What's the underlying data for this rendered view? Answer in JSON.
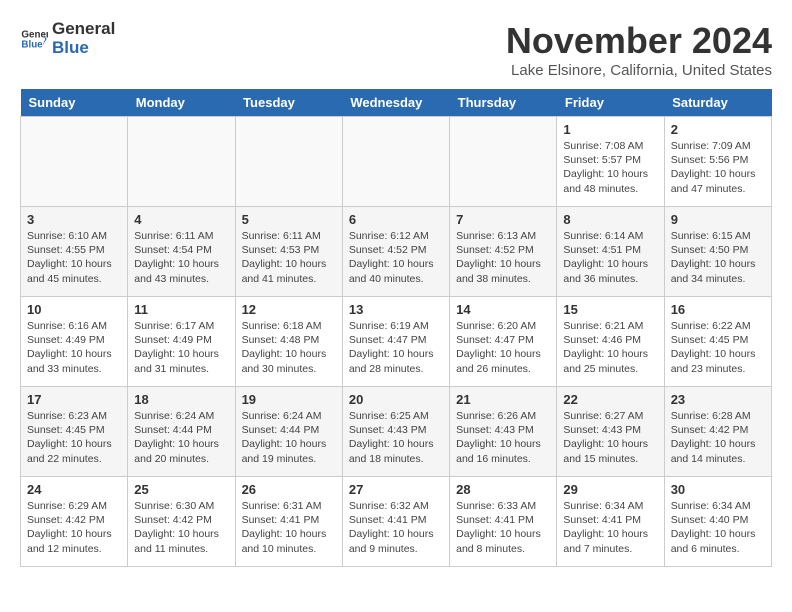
{
  "logo": {
    "line1": "General",
    "line2": "Blue"
  },
  "title": "November 2024",
  "location": "Lake Elsinore, California, United States",
  "weekdays": [
    "Sunday",
    "Monday",
    "Tuesday",
    "Wednesday",
    "Thursday",
    "Friday",
    "Saturday"
  ],
  "weeks": [
    [
      {
        "day": "",
        "info": ""
      },
      {
        "day": "",
        "info": ""
      },
      {
        "day": "",
        "info": ""
      },
      {
        "day": "",
        "info": ""
      },
      {
        "day": "",
        "info": ""
      },
      {
        "day": "1",
        "info": "Sunrise: 7:08 AM\nSunset: 5:57 PM\nDaylight: 10 hours\nand 48 minutes."
      },
      {
        "day": "2",
        "info": "Sunrise: 7:09 AM\nSunset: 5:56 PM\nDaylight: 10 hours\nand 47 minutes."
      }
    ],
    [
      {
        "day": "3",
        "info": "Sunrise: 6:10 AM\nSunset: 4:55 PM\nDaylight: 10 hours\nand 45 minutes."
      },
      {
        "day": "4",
        "info": "Sunrise: 6:11 AM\nSunset: 4:54 PM\nDaylight: 10 hours\nand 43 minutes."
      },
      {
        "day": "5",
        "info": "Sunrise: 6:11 AM\nSunset: 4:53 PM\nDaylight: 10 hours\nand 41 minutes."
      },
      {
        "day": "6",
        "info": "Sunrise: 6:12 AM\nSunset: 4:52 PM\nDaylight: 10 hours\nand 40 minutes."
      },
      {
        "day": "7",
        "info": "Sunrise: 6:13 AM\nSunset: 4:52 PM\nDaylight: 10 hours\nand 38 minutes."
      },
      {
        "day": "8",
        "info": "Sunrise: 6:14 AM\nSunset: 4:51 PM\nDaylight: 10 hours\nand 36 minutes."
      },
      {
        "day": "9",
        "info": "Sunrise: 6:15 AM\nSunset: 4:50 PM\nDaylight: 10 hours\nand 34 minutes."
      }
    ],
    [
      {
        "day": "10",
        "info": "Sunrise: 6:16 AM\nSunset: 4:49 PM\nDaylight: 10 hours\nand 33 minutes."
      },
      {
        "day": "11",
        "info": "Sunrise: 6:17 AM\nSunset: 4:49 PM\nDaylight: 10 hours\nand 31 minutes."
      },
      {
        "day": "12",
        "info": "Sunrise: 6:18 AM\nSunset: 4:48 PM\nDaylight: 10 hours\nand 30 minutes."
      },
      {
        "day": "13",
        "info": "Sunrise: 6:19 AM\nSunset: 4:47 PM\nDaylight: 10 hours\nand 28 minutes."
      },
      {
        "day": "14",
        "info": "Sunrise: 6:20 AM\nSunset: 4:47 PM\nDaylight: 10 hours\nand 26 minutes."
      },
      {
        "day": "15",
        "info": "Sunrise: 6:21 AM\nSunset: 4:46 PM\nDaylight: 10 hours\nand 25 minutes."
      },
      {
        "day": "16",
        "info": "Sunrise: 6:22 AM\nSunset: 4:45 PM\nDaylight: 10 hours\nand 23 minutes."
      }
    ],
    [
      {
        "day": "17",
        "info": "Sunrise: 6:23 AM\nSunset: 4:45 PM\nDaylight: 10 hours\nand 22 minutes."
      },
      {
        "day": "18",
        "info": "Sunrise: 6:24 AM\nSunset: 4:44 PM\nDaylight: 10 hours\nand 20 minutes."
      },
      {
        "day": "19",
        "info": "Sunrise: 6:24 AM\nSunset: 4:44 PM\nDaylight: 10 hours\nand 19 minutes."
      },
      {
        "day": "20",
        "info": "Sunrise: 6:25 AM\nSunset: 4:43 PM\nDaylight: 10 hours\nand 18 minutes."
      },
      {
        "day": "21",
        "info": "Sunrise: 6:26 AM\nSunset: 4:43 PM\nDaylight: 10 hours\nand 16 minutes."
      },
      {
        "day": "22",
        "info": "Sunrise: 6:27 AM\nSunset: 4:43 PM\nDaylight: 10 hours\nand 15 minutes."
      },
      {
        "day": "23",
        "info": "Sunrise: 6:28 AM\nSunset: 4:42 PM\nDaylight: 10 hours\nand 14 minutes."
      }
    ],
    [
      {
        "day": "24",
        "info": "Sunrise: 6:29 AM\nSunset: 4:42 PM\nDaylight: 10 hours\nand 12 minutes."
      },
      {
        "day": "25",
        "info": "Sunrise: 6:30 AM\nSunset: 4:42 PM\nDaylight: 10 hours\nand 11 minutes."
      },
      {
        "day": "26",
        "info": "Sunrise: 6:31 AM\nSunset: 4:41 PM\nDaylight: 10 hours\nand 10 minutes."
      },
      {
        "day": "27",
        "info": "Sunrise: 6:32 AM\nSunset: 4:41 PM\nDaylight: 10 hours\nand 9 minutes."
      },
      {
        "day": "28",
        "info": "Sunrise: 6:33 AM\nSunset: 4:41 PM\nDaylight: 10 hours\nand 8 minutes."
      },
      {
        "day": "29",
        "info": "Sunrise: 6:34 AM\nSunset: 4:41 PM\nDaylight: 10 hours\nand 7 minutes."
      },
      {
        "day": "30",
        "info": "Sunrise: 6:34 AM\nSunset: 4:40 PM\nDaylight: 10 hours\nand 6 minutes."
      }
    ]
  ]
}
